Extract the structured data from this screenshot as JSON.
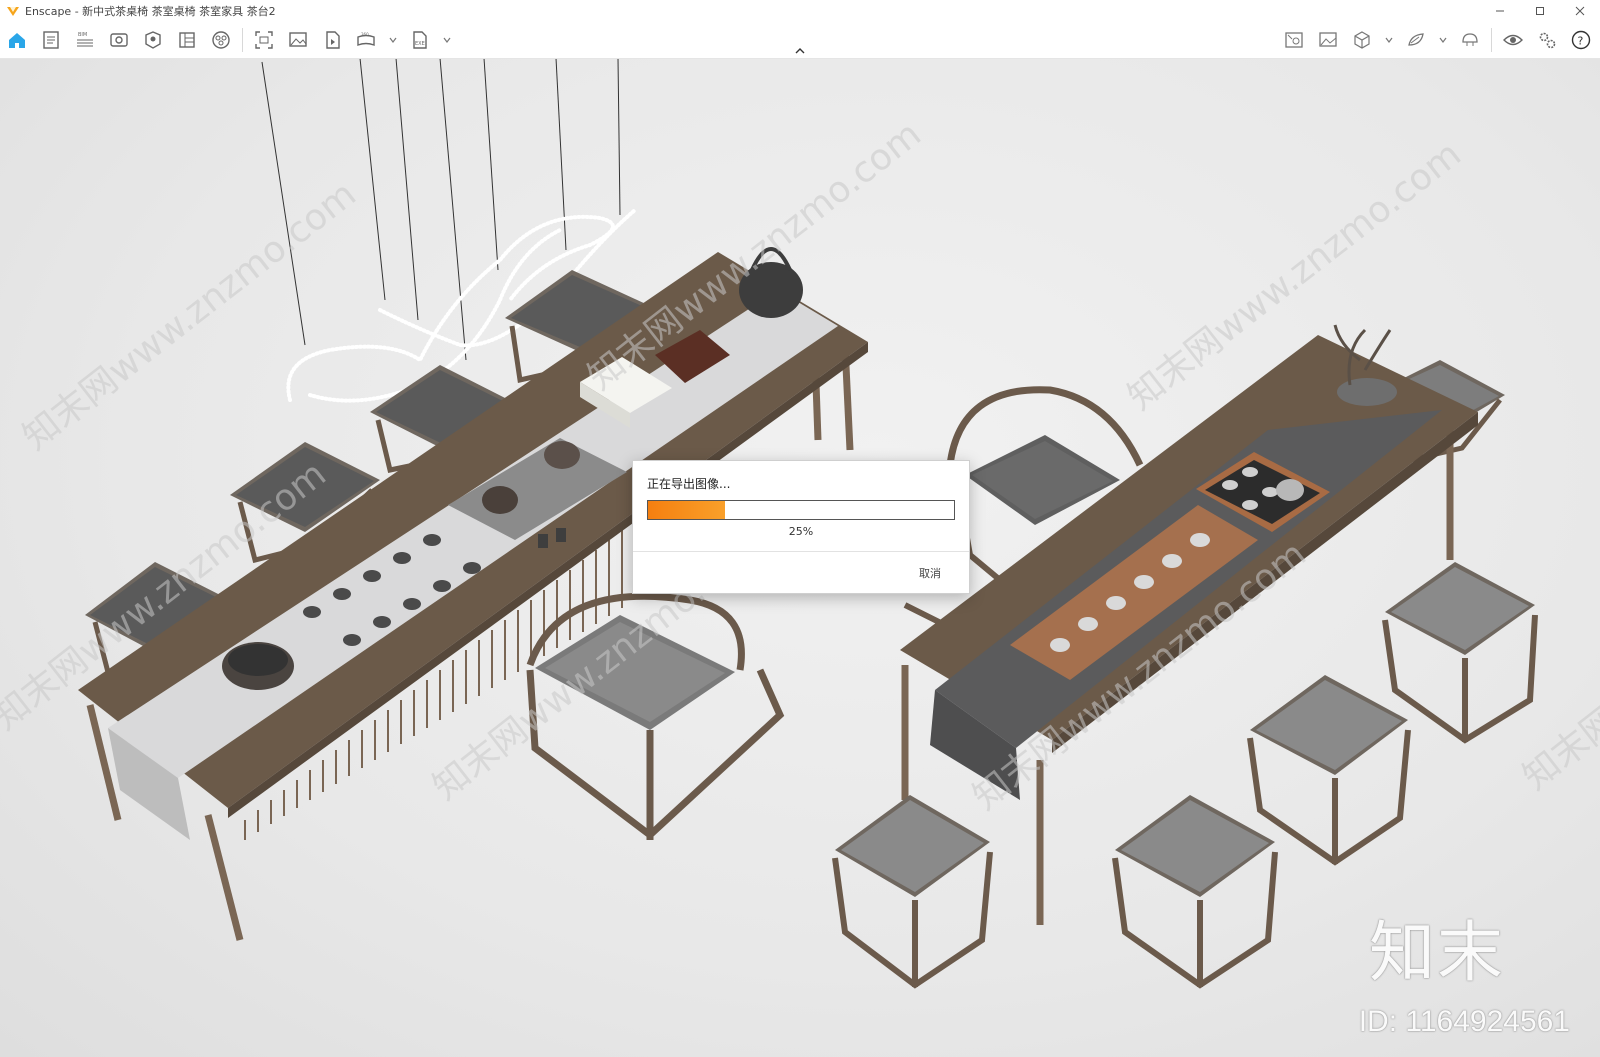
{
  "window": {
    "app_name": "Enscape",
    "title": "Enscape - 新中式茶桌椅 茶室桌椅 茶室家具 茶台2",
    "controls": [
      "minimize-icon",
      "maximize-icon",
      "close-icon"
    ]
  },
  "toolbar": {
    "left_icons": [
      "home-icon",
      "visual-settings-icon",
      "bim-icon",
      "views-icon",
      "asset-library-icon",
      "material-editor-icon",
      "site-context-icon",
      "screenshot-icon",
      "render-image-icon",
      "video-editor-icon",
      "panorama-icon",
      "exe-export-icon"
    ],
    "right_icons": [
      "sync-views-icon",
      "image-export-icon",
      "cube-view-icon",
      "vr-icon",
      "collaborate-icon",
      "eye-icon",
      "settings-icon",
      "help-icon"
    ],
    "collapse_icon": "chevron-up-icon"
  },
  "dialog": {
    "title": "正在导出图像...",
    "progress": 0.25,
    "progress_label": "25%",
    "cancel_label": "取消",
    "accent_color": "#f58a18"
  },
  "watermarks": {
    "diagonal_text": "知末网www.znzmo.com",
    "logo_text": "知末",
    "id_text": "ID: 1164924561"
  }
}
